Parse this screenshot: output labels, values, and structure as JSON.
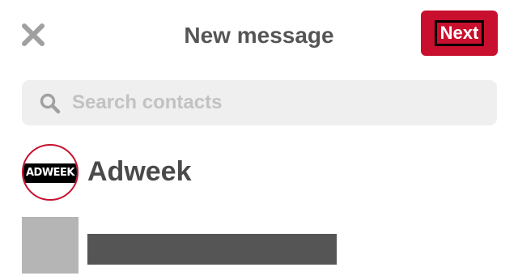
{
  "header": {
    "title": "New message",
    "next_label": "Next",
    "close_icon": "close-icon"
  },
  "search": {
    "placeholder": "Search contacts",
    "value": "",
    "icon": "search-icon"
  },
  "contacts": [
    {
      "name": "Adweek",
      "avatar_text": "ADWEEK",
      "avatar_border_color": "#c8102e"
    },
    {
      "name": "",
      "name_redacted": true
    }
  ],
  "colors": {
    "accent": "#c8102e",
    "title_text": "#555555",
    "icon_gray": "#a0a0a0",
    "search_bg": "#efefef",
    "placeholder_text": "#c2c2c2"
  }
}
